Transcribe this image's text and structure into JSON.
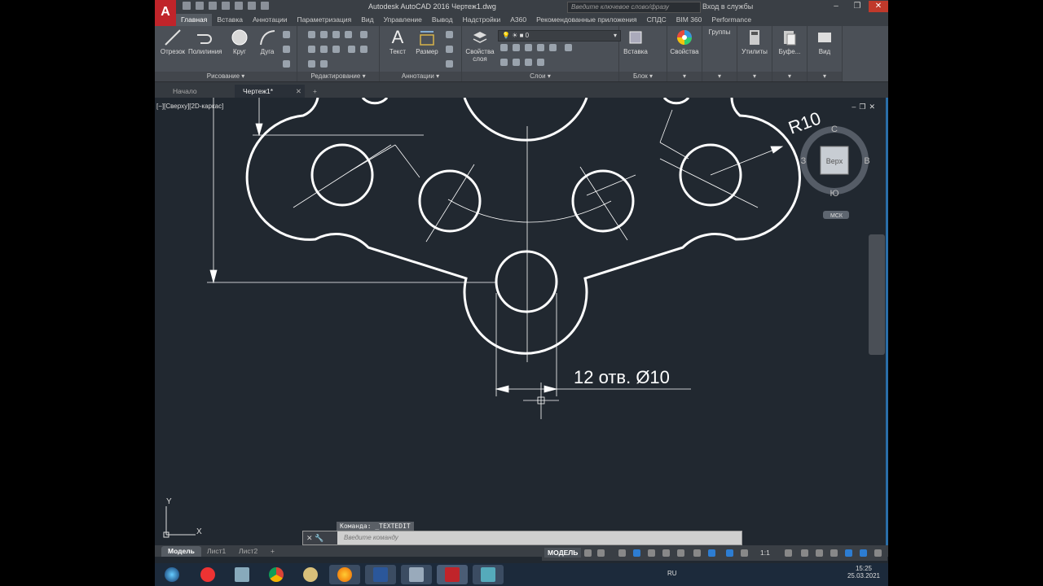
{
  "titlebar": {
    "logo": "A",
    "title": "Autodesk AutoCAD 2016    Чертеж1.dwg",
    "search_placeholder": "Введите ключевое слово/фразу",
    "login": "Вход в службы"
  },
  "menu_tabs": [
    "Главная",
    "Вставка",
    "Аннотации",
    "Параметризация",
    "Вид",
    "Управление",
    "Вывод",
    "Надстройки",
    "A360",
    "Рекомендованные приложения",
    "СПДС",
    "BIM 360",
    "Performance"
  ],
  "ribbon": {
    "draw": {
      "title": "Рисование ▾",
      "tools": [
        "Отрезок",
        "Полилиния",
        "Круг",
        "Дуга"
      ]
    },
    "modify": {
      "title": "Редактирование ▾"
    },
    "annot": {
      "title": "Аннотации ▾",
      "tools": [
        "Текст",
        "Размер"
      ]
    },
    "layers": {
      "title": "Слои ▾",
      "props_label": "Свойства слоя",
      "layer_value": "0"
    },
    "block": {
      "title": "Блок ▾",
      "tool": "Вставка"
    },
    "properties": "Свойства",
    "groups": "Группы",
    "utilities": "Утилиты",
    "clipboard": "Буфе...",
    "view": "Вид"
  },
  "file_tabs": {
    "start": "Начало",
    "drawing": "Чертеж1*"
  },
  "viewport": {
    "label": "[−][Сверху][2D-каркас]",
    "dim_radius": "R10",
    "dim_holes": "12 отв. Ø10",
    "viewcube": {
      "top": "Верх",
      "north": "С",
      "south": "Ю",
      "west": "З",
      "east": "В",
      "wcs": "МСК"
    },
    "ucs_x": "X",
    "ucs_y": "Y"
  },
  "command": {
    "history": "Команда: _TEXTEDIT",
    "placeholder": "Введите команду"
  },
  "layout_tabs": [
    "Модель",
    "Лист1",
    "Лист2"
  ],
  "status": {
    "model": "МОДЕЛЬ",
    "scale": "1:1"
  },
  "tray": {
    "lang": "RU",
    "time": "15:25",
    "date": "25.03.2021"
  }
}
